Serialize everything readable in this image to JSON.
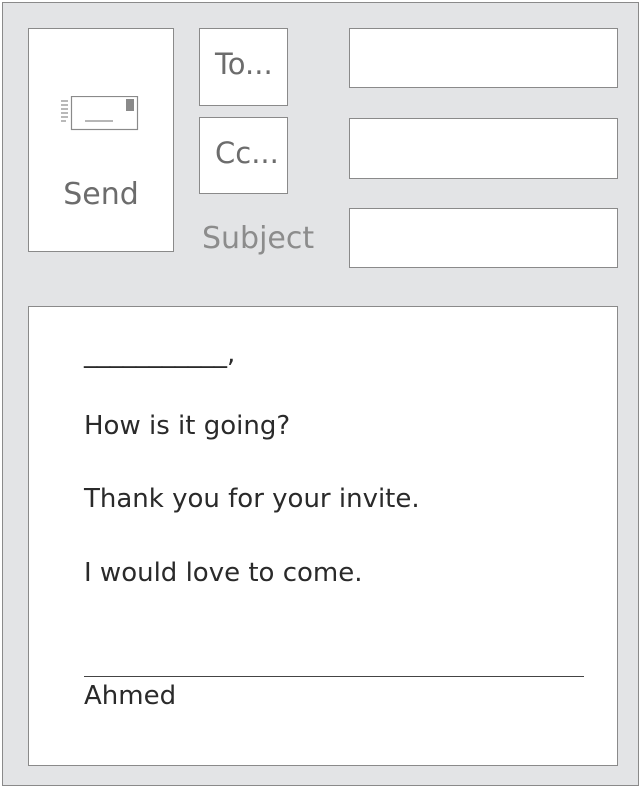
{
  "header": {
    "send_label": "Send",
    "to_label": "To...",
    "cc_label": "Cc...",
    "subject_label": "Subject",
    "to_value": "",
    "cc_value": "",
    "subject_value": ""
  },
  "body": {
    "greeting_blank": "___________,",
    "lines": [
      "How is it going?",
      "Thank you for your invite.",
      "I would love to come."
    ],
    "signature": "Ahmed"
  },
  "icons": {
    "send": "envelope-icon"
  },
  "colors": {
    "background": "#e3e4e6",
    "border": "#8a8a8a",
    "label_text": "#6c6c6c",
    "body_text": "#2a2a2a"
  }
}
